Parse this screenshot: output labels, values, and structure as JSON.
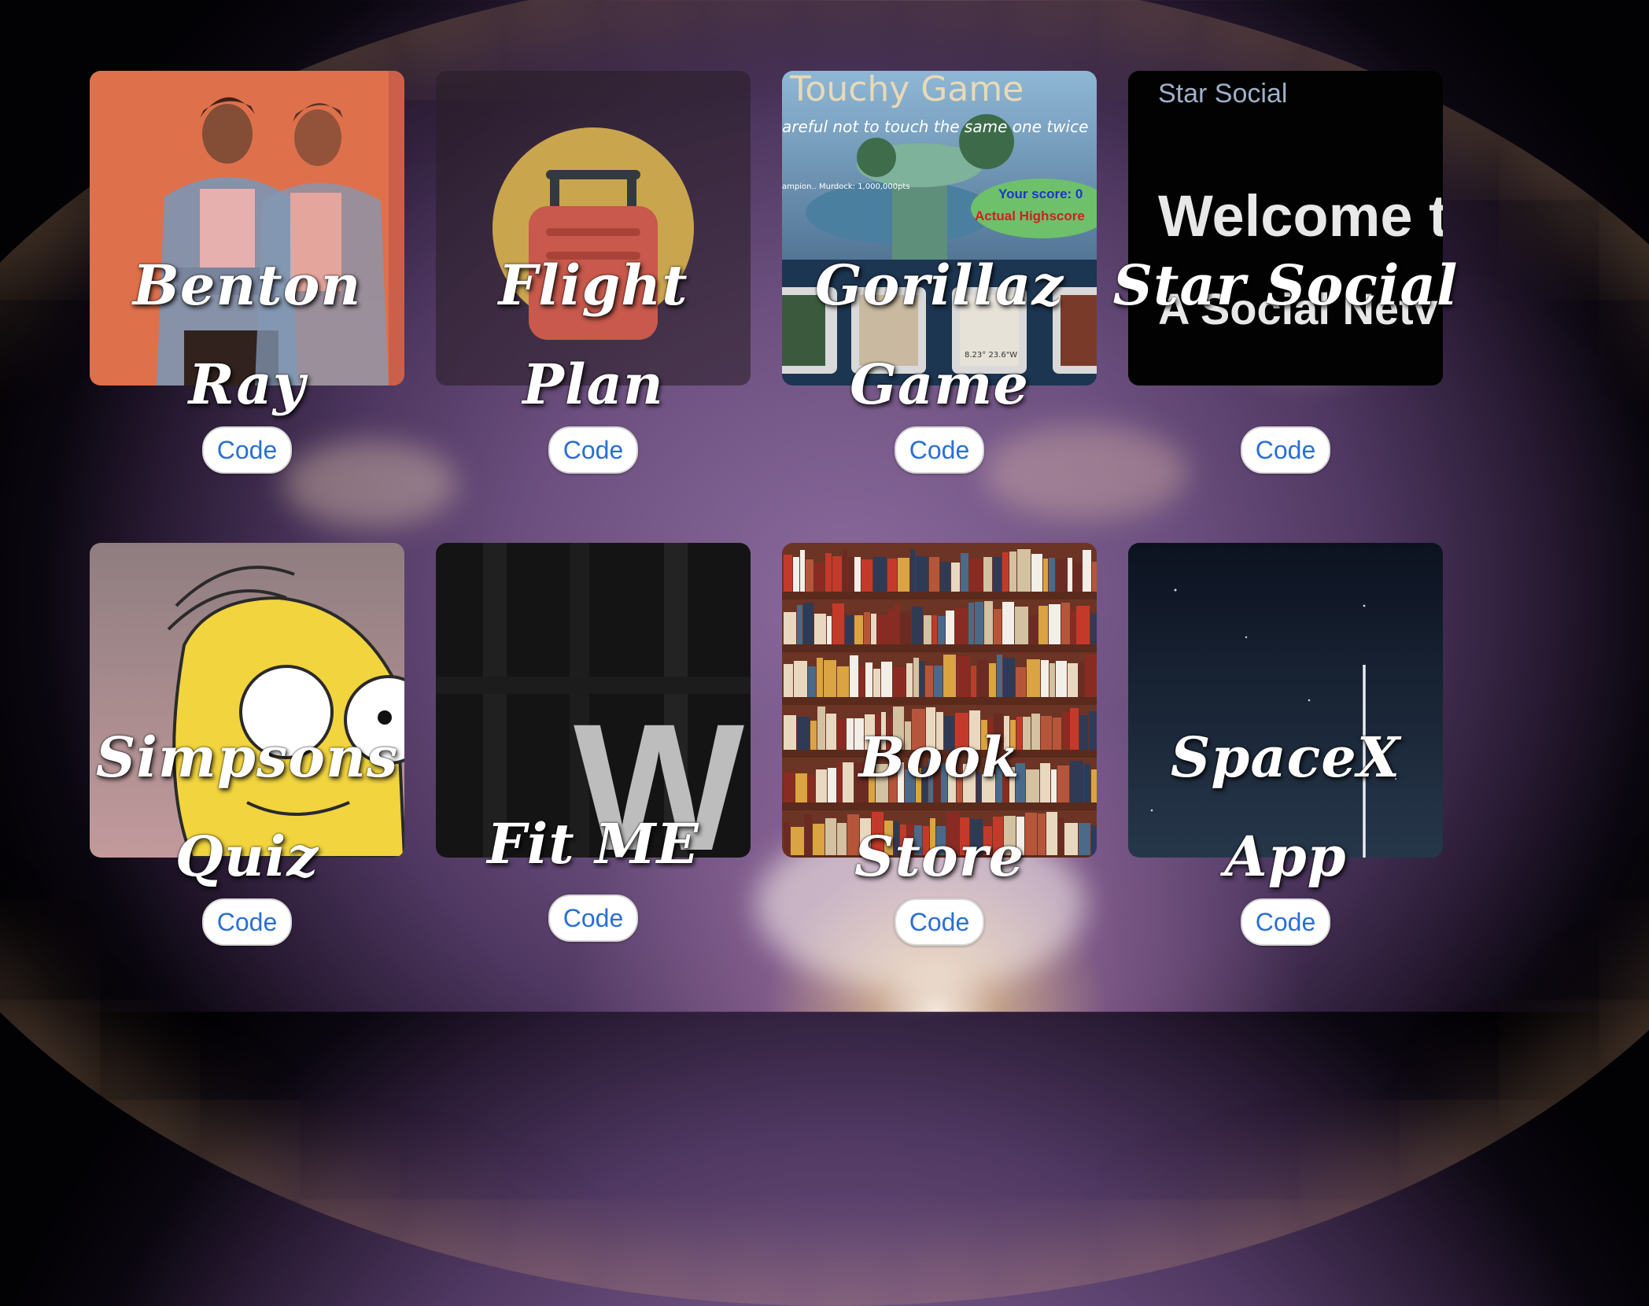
{
  "projects": [
    {
      "title": "Benton Ray",
      "code_label": "Code",
      "thumb_icon": "benton-ray-photo"
    },
    {
      "title": "Flight Plan",
      "code_label": "Code",
      "thumb_icon": "suitcase-icon"
    },
    {
      "title": "Gorillaz Game",
      "code_label": "Code",
      "thumb_icon": "touchy-game-screenshot",
      "thumb_text": {
        "heading": "Touchy Game",
        "subtitle": "areful not to touch the same one twice",
        "champion": "ampion.. Murdock: 1,000,000pts",
        "score": "Your score: 0",
        "highscore": "Actual Highscore",
        "coords": "8.23° 23.6\"W"
      }
    },
    {
      "title": "Star Social",
      "code_label": "Code",
      "thumb_icon": "star-social-screenshot",
      "thumb_text": {
        "brand": "Star Social",
        "welcome": "Welcome t",
        "tagline": "A Social Netv"
      }
    },
    {
      "title": "Simpsons Quiz",
      "code_label": "Code",
      "thumb_icon": "homer-simpson-image"
    },
    {
      "title": "Fit ME",
      "code_label": "Code",
      "thumb_icon": "fitme-w-image",
      "thumb_text": {
        "letter": "W"
      }
    },
    {
      "title": "Book Store",
      "code_label": "Code",
      "thumb_icon": "bookshelf-photo"
    },
    {
      "title": "SpaceX App",
      "code_label": "Code",
      "thumb_icon": "rocket-launch-night-photo"
    }
  ],
  "colors": {
    "link_blue": "#2a6fd6",
    "button_bg": "#ffffff"
  }
}
